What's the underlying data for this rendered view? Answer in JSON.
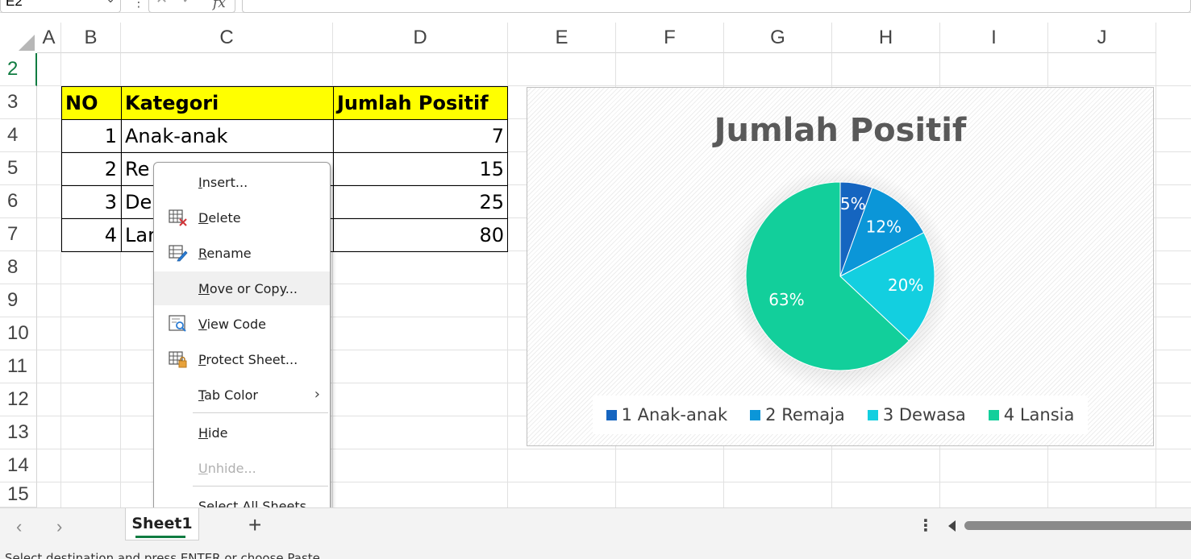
{
  "formula_bar": {
    "name_box": "E2",
    "separator": "⋮",
    "cancel_icon": "✕",
    "enter_icon": "✓",
    "fx_label": "fx"
  },
  "columns": [
    "A",
    "B",
    "C",
    "D",
    "E",
    "F",
    "G",
    "H",
    "I",
    "J"
  ],
  "rows": [
    "2",
    "3",
    "4",
    "5",
    "6",
    "7",
    "8",
    "9",
    "10",
    "11",
    "12",
    "13",
    "14",
    "15"
  ],
  "table": {
    "header": {
      "no": "NO",
      "kategori": "Kategori",
      "jumlah": "Jumlah Positif"
    },
    "rows": [
      {
        "no": "1",
        "kategori": "Anak-anak",
        "jumlah": "7"
      },
      {
        "no": "2",
        "kategori": "Re",
        "jumlah": "15"
      },
      {
        "no": "3",
        "kategori": "De",
        "jumlah": "25"
      },
      {
        "no": "4",
        "kategori": "Lar",
        "jumlah": "80"
      }
    ],
    "header_color": "#ffff00"
  },
  "chart_data": {
    "type": "pie",
    "title": "Jumlah Positif",
    "categories": [
      "1 Anak-anak",
      "2 Remaja",
      "3 Dewasa",
      "4 Lansia"
    ],
    "values": [
      7,
      15,
      25,
      80
    ],
    "labels": [
      "5%",
      "12%",
      "20%",
      "63%"
    ],
    "colors": [
      "#1565c0",
      "#0b96d8",
      "#13cfe0",
      "#12cf9b"
    ],
    "legend_position": "bottom"
  },
  "context_menu": {
    "items": [
      {
        "id": "insert",
        "pre": "",
        "u": "I",
        "post": "nsert...",
        "icon": "",
        "disabled": false
      },
      {
        "id": "delete",
        "pre": "",
        "u": "D",
        "post": "elete",
        "icon": "delete-sheet-icon",
        "disabled": false
      },
      {
        "id": "rename",
        "pre": "",
        "u": "R",
        "post": "ename",
        "icon": "rename-sheet-icon",
        "disabled": false
      },
      {
        "id": "move-or-copy",
        "pre": "",
        "u": "M",
        "post": "ove or Copy...",
        "icon": "",
        "disabled": false
      },
      {
        "id": "view-code",
        "pre": "",
        "u": "V",
        "post": "iew Code",
        "icon": "view-code-icon",
        "disabled": false
      },
      {
        "id": "protect-sheet",
        "pre": "",
        "u": "P",
        "post": "rotect Sheet...",
        "icon": "protect-sheet-icon",
        "disabled": false
      },
      {
        "id": "tab-color",
        "pre": "",
        "u": "T",
        "post": "ab Color",
        "icon": "",
        "disabled": false
      },
      {
        "id": "hide",
        "pre": "",
        "u": "H",
        "post": "ide",
        "icon": "",
        "disabled": false
      },
      {
        "id": "unhide",
        "pre": "",
        "u": "U",
        "post": "nhide...",
        "icon": "",
        "disabled": true
      },
      {
        "id": "select-all-sheets",
        "pre": "",
        "u": "S",
        "post": "elect All Sheets",
        "icon": "",
        "disabled": false
      }
    ],
    "submenu_arrow": "›",
    "hovered": "move-or-copy"
  },
  "sheet_tabs": {
    "prev_arrow": "‹",
    "next_arrow": "›",
    "active_tab": "Sheet1",
    "add_sheet": "+",
    "more": "⋮",
    "accent": "#107c41"
  },
  "status_bar": {
    "message": "Select destination and press ENTER or choose Paste"
  }
}
